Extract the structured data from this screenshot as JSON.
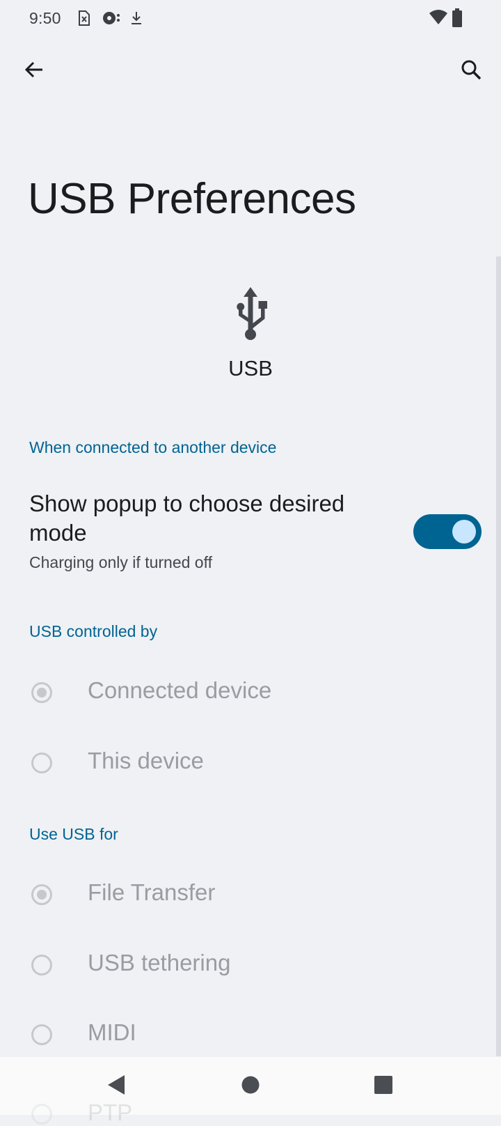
{
  "status_bar": {
    "time": "9:50",
    "left_icons": [
      "sim-error-icon",
      "cast-icon",
      "download-icon"
    ],
    "right_icons": [
      "wifi-icon",
      "battery-icon"
    ]
  },
  "toolbar": {
    "back_icon": "arrow-back-icon",
    "search_icon": "search-icon"
  },
  "page": {
    "title": "USB Preferences",
    "hero_icon": "usb-icon",
    "hero_label": "USB"
  },
  "sections": {
    "connected": {
      "header": "When connected to another device",
      "popup_pref": {
        "title": "Show popup to choose desired mode",
        "summary": "Charging only if turned off",
        "enabled": true
      }
    },
    "controlled_by": {
      "header": "USB controlled by",
      "options": [
        {
          "label": "Connected device",
          "checked": true
        },
        {
          "label": "This device",
          "checked": false
        }
      ]
    },
    "use_for": {
      "header": "Use USB for",
      "options": [
        {
          "label": "File Transfer",
          "checked": true
        },
        {
          "label": "USB tethering",
          "checked": false
        },
        {
          "label": "MIDI",
          "checked": false
        },
        {
          "label": "PTP",
          "checked": false
        }
      ]
    }
  },
  "nav_bar": {
    "back_icon": "nav-back-icon",
    "home_icon": "nav-home-icon",
    "recents_icon": "nav-recents-icon"
  },
  "colors": {
    "background": "#eff1f4",
    "accent": "#006492",
    "switch_thumb": "#c9e6ff",
    "disabled_text": "#999ca1"
  }
}
